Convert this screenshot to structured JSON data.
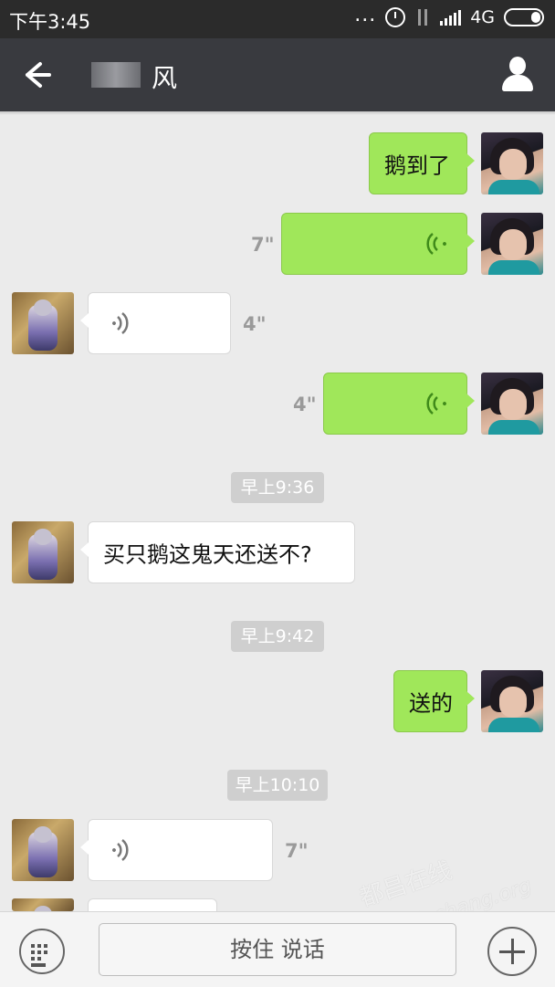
{
  "status_bar": {
    "time": "下午3:45",
    "dots": "...",
    "network": "4G",
    "icons": [
      "alarm-icon",
      "data-arrows-icon",
      "signal-icon",
      "battery-icon"
    ]
  },
  "nav": {
    "back_icon": "back-arrow-icon",
    "title": "风",
    "profile_icon": "user-profile-icon"
  },
  "messages": [
    {
      "side": "me",
      "type": "text",
      "text": "鹅到了"
    },
    {
      "side": "me",
      "type": "voice",
      "duration": "7\""
    },
    {
      "side": "them",
      "type": "voice",
      "duration": "4\""
    },
    {
      "side": "me",
      "type": "voice",
      "duration": "4\""
    },
    {
      "side": "system",
      "type": "timestamp",
      "text": "早上9:36"
    },
    {
      "side": "them",
      "type": "text",
      "text": "买只鹅这鬼天还送不?"
    },
    {
      "side": "system",
      "type": "timestamp",
      "text": "早上9:42"
    },
    {
      "side": "me",
      "type": "text",
      "text": "送的"
    },
    {
      "side": "system",
      "type": "timestamp",
      "text": "早上10:10"
    },
    {
      "side": "them",
      "type": "voice",
      "duration": "7\""
    }
  ],
  "input_bar": {
    "keyboard_icon": "keyboard-icon",
    "hold_to_talk": "按住 说话",
    "plus_icon": "plus-icon"
  },
  "watermark": {
    "line1": "都昌在线",
    "line2": "www.duchang.org"
  },
  "colors": {
    "status_bar_bg": "#2b2b2b",
    "nav_bg": "#393a3f",
    "chat_bg": "#ebebeb",
    "my_bubble": "#a0e75a",
    "their_bubble": "#ffffff",
    "timestamp_bg": "#cfcfcf"
  }
}
